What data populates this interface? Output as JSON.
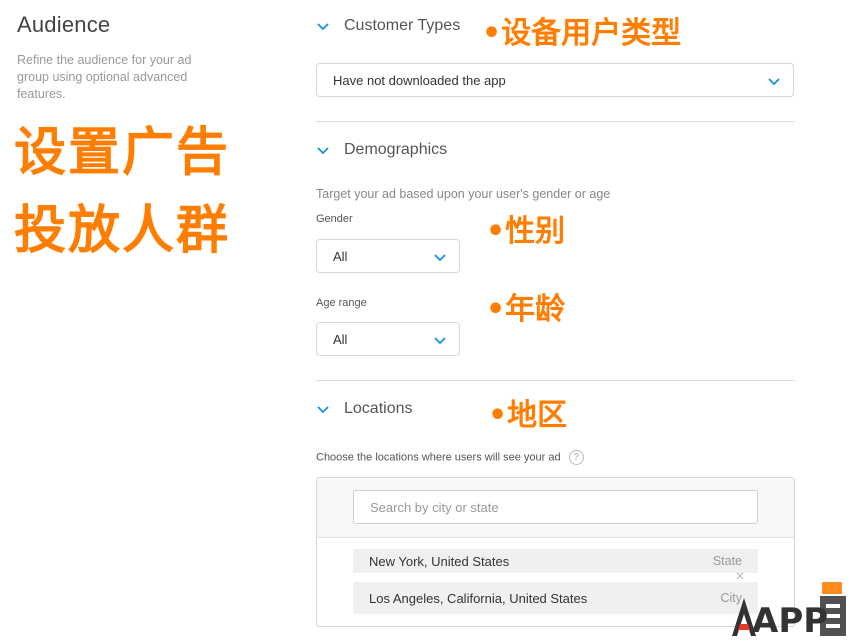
{
  "sidebar": {
    "title": "Audience",
    "description": "Refine the audience for your ad group using optional advanced features."
  },
  "overlay": {
    "headline_line1": "设置广告",
    "headline_line2": "投放人群",
    "customer_types_note": "•设备用户类型",
    "gender_note": "•性别",
    "age_note": "•年龄",
    "locations_note": "•地区"
  },
  "customer_types": {
    "title": "Customer Types",
    "selected": "Have not downloaded the app"
  },
  "demographics": {
    "title": "Demographics",
    "hint": "Target your ad based upon your user's gender or age",
    "gender_label": "Gender",
    "gender_selected": "All",
    "age_label": "Age range",
    "age_selected": "All"
  },
  "locations": {
    "title": "Locations",
    "hint": "Choose the locations where users will see your ad",
    "help_glyph": "?",
    "search_placeholder": "Search by city or state",
    "items": [
      {
        "name": "New York, United States",
        "type": "State"
      },
      {
        "name": "Los Angeles, California, United States",
        "type": "City"
      }
    ],
    "remove_glyph": "×"
  },
  "watermark": {
    "text": "APP"
  },
  "colors": {
    "accent": "#1a8fe0",
    "overlay": "#ff7d00",
    "text": "#333333",
    "muted": "#999999"
  }
}
